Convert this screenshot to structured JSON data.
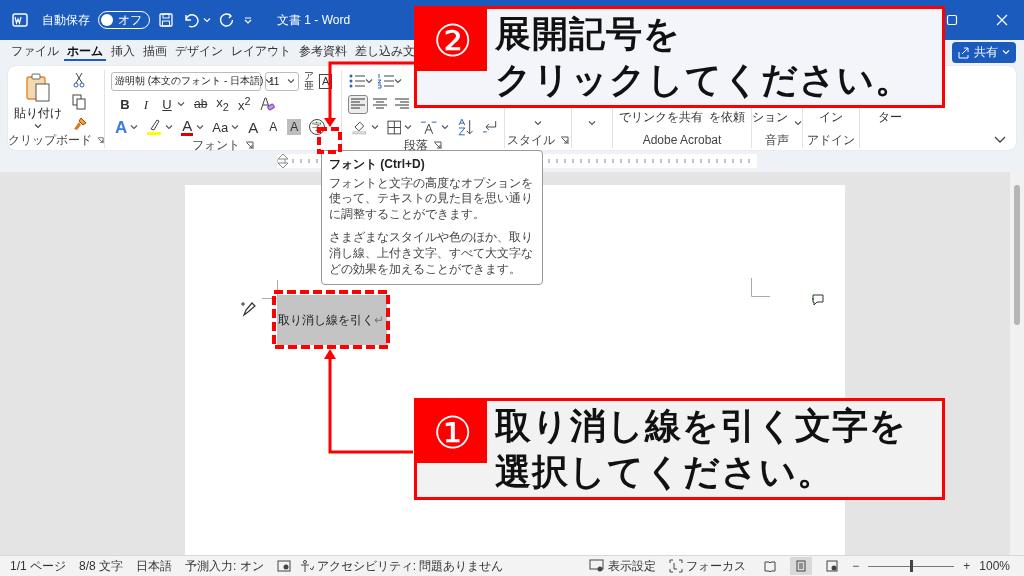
{
  "title_bar": {
    "autosave_label": "自動保存",
    "autosave": {
      "on": false,
      "label": "オフ"
    },
    "title": "文書 1 - Word"
  },
  "tabs": [
    {
      "label": "ファイル",
      "selected": false
    },
    {
      "label": "ホーム",
      "selected": true
    },
    {
      "label": "挿入",
      "selected": false
    },
    {
      "label": "描画",
      "selected": false
    },
    {
      "label": "デザイン",
      "selected": false
    },
    {
      "label": "レイアウト",
      "selected": false
    },
    {
      "label": "参考資料",
      "selected": false
    },
    {
      "label": "差し込み文",
      "selected": false
    }
  ],
  "tab_actions": {
    "share": "共有"
  },
  "ribbon": {
    "clipboard": {
      "paste": "貼り付け",
      "label": "クリップボード"
    },
    "font": {
      "font_name": "游明朝 (本文のフォント - 日本語)",
      "font_size": "11",
      "phonetic": "ア亜",
      "border_char": "A",
      "format": [
        "B",
        "I",
        "U",
        "ab",
        "x$_{2}$",
        "x$^{2}$"
      ],
      "effects": [
        "A",
        "A",
        "Aa",
        "A",
        "A",
        "A",
        "字"
      ],
      "label": "フォント"
    },
    "paragraph": {
      "alignments": [
        {
          "selected": true
        },
        {
          "selected": false
        },
        {
          "selected": false
        }
      ],
      "label": "段落"
    },
    "styles": {
      "label": "スタイル"
    },
    "acrobat": {
      "buttons": [
        "でリンクを共有",
        "を依頼"
      ],
      "label": "Adobe Acrobat"
    },
    "voice": {
      "button": "ション",
      "label": "音声"
    },
    "addins": {
      "button": "イン",
      "label": "アドイン"
    },
    "editor": {
      "button": "ター"
    }
  },
  "tooltip": {
    "title": "フォント (Ctrl+D)",
    "paragraphs": [
      "フォントと文字の高度なオプションを使って、テキストの見た目を思い通りに調整することができます。",
      "さまざまなスタイルや色のほか、取り消し線、上付き文字、すべて大文字などの効果を加えることができます。"
    ]
  },
  "document": {
    "text": "取り消し線を引く",
    "paragraph_mark": "↵"
  },
  "callouts": [
    {
      "number": "②",
      "lines": [
        "展開記号を",
        "クリックしてください。"
      ]
    },
    {
      "number": "①",
      "lines": [
        "取り消し線を引く文字を",
        "選択してください。"
      ]
    }
  ],
  "status_bar": {
    "page": "1/1 ページ",
    "chars": "8/8 文字",
    "language": "日本語",
    "prediction": "予測入力: オン",
    "accessibility": "アクセシビリティ: 問題ありません",
    "display": "表示設定",
    "focus": "フォーカス",
    "views": [
      {
        "selected": false
      },
      {
        "selected": true
      },
      {
        "selected": false
      }
    ],
    "zoom_out": "−",
    "zoom": {
      "level": 0.5
    },
    "zoom_in": "+",
    "zoom_label": "100%"
  }
}
